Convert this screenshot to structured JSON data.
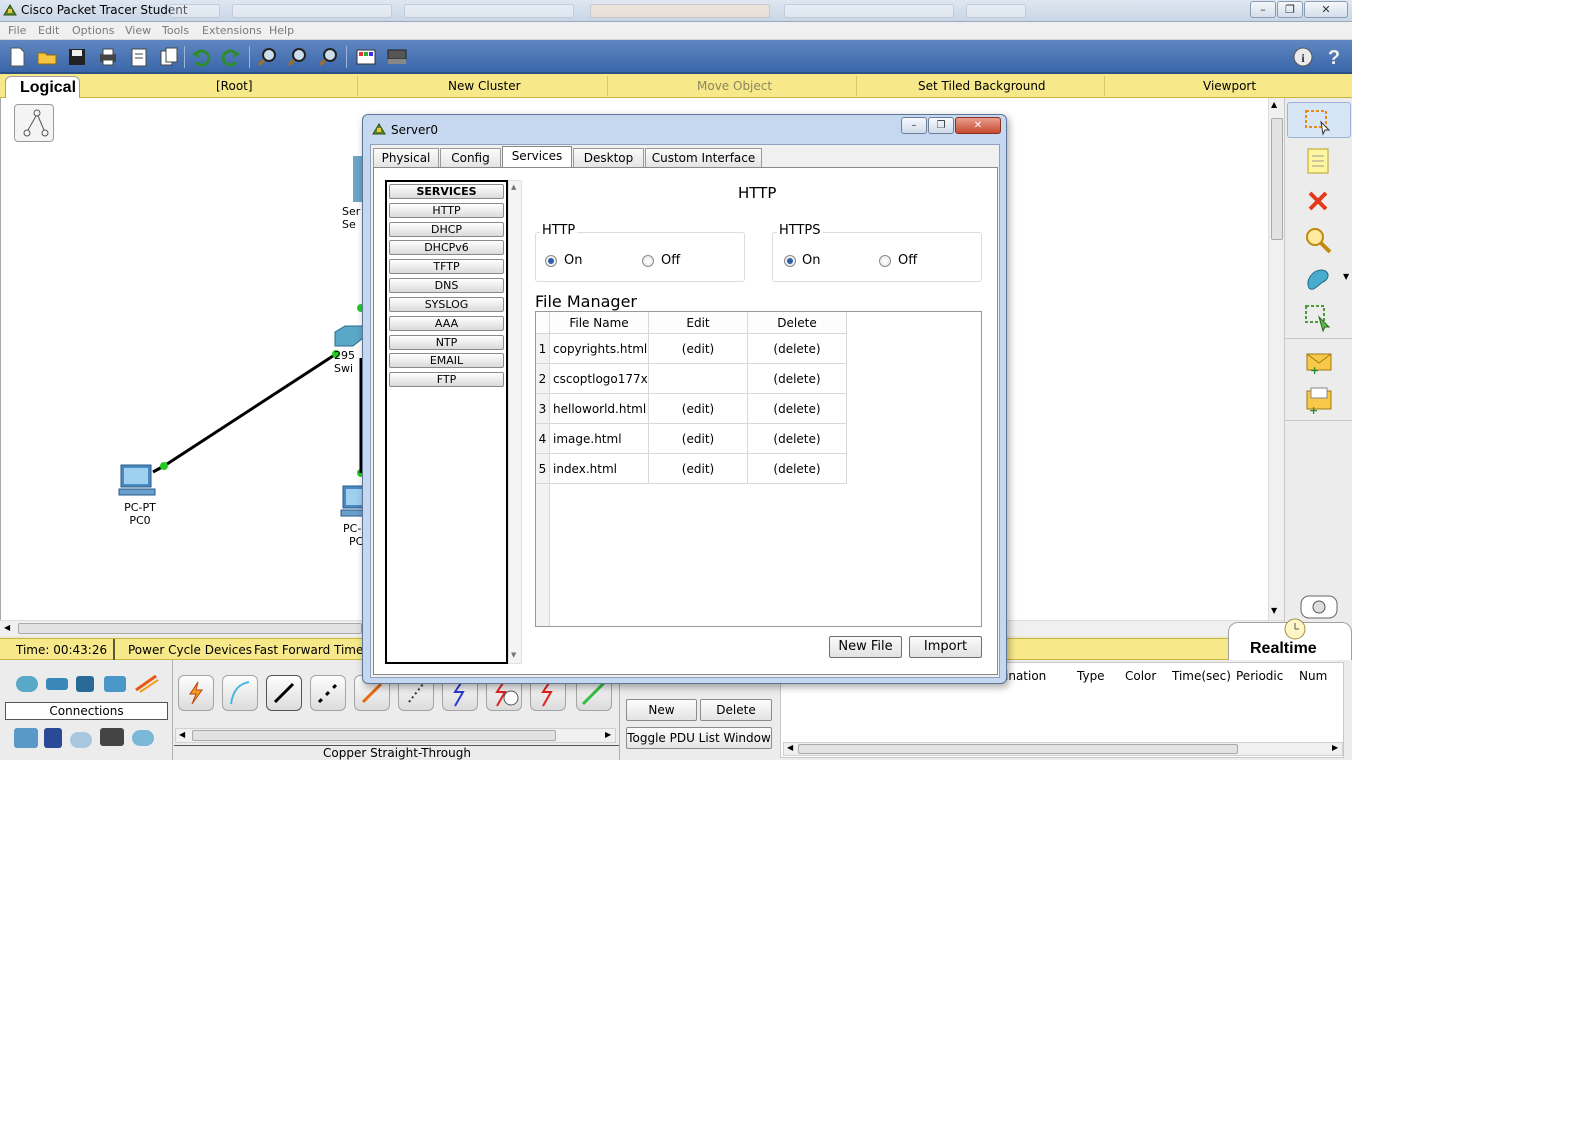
{
  "window": {
    "title": "Cisco Packet Tracer Student",
    "minimize": "–",
    "restore": "❐",
    "close": "✕"
  },
  "menu": [
    "File",
    "Edit",
    "Options",
    "View",
    "Tools",
    "Extensions",
    "Help"
  ],
  "toolbar_icons": [
    "new-file-icon",
    "open-folder-icon",
    "save-icon",
    "print-icon",
    "activity-wizard-icon",
    "copy-icon",
    "undo-icon",
    "redo-icon",
    "zoom-in-icon",
    "zoom-reset-icon",
    "zoom-out-icon",
    "palette-icon",
    "custom-device-icon",
    "info-icon",
    "help-icon"
  ],
  "logical_bar": {
    "tab": "Logical",
    "items": [
      "[Root]",
      "New Cluster",
      "Move Object",
      "Set Tiled Background",
      "Viewport"
    ]
  },
  "workspace": {
    "devices": [
      {
        "line1": "PC-PT",
        "line2": "PC0"
      },
      {
        "line1": "295",
        "line2": "Swi"
      },
      {
        "line1": "Ser",
        "line2": "Se"
      },
      {
        "line1": "PC-",
        "line2": "PC"
      }
    ]
  },
  "status": {
    "time": "Time: 00:43:26",
    "power_cycle": "Power Cycle Devices",
    "fast_forward": "Fast Forward Time",
    "mode": "Realtime"
  },
  "bottom": {
    "connections_label": "Connections",
    "connection_caption": "Copper Straight-Through",
    "new_button": "New",
    "delete_button": "Delete",
    "toggle_button": "Toggle PDU List Window",
    "pdu_columns": [
      "ination",
      "Type",
      "Color",
      "Time(sec)",
      "Periodic",
      "Num"
    ]
  },
  "dialog": {
    "title": "Server0",
    "tabs": [
      "Physical",
      "Config",
      "Services",
      "Desktop",
      "Custom Interface"
    ],
    "active_tab": "Services",
    "services": [
      "SERVICES",
      "HTTP",
      "DHCP",
      "DHCPv6",
      "TFTP",
      "DNS",
      "SYSLOG",
      "AAA",
      "NTP",
      "EMAIL",
      "FTP"
    ],
    "heading": "HTTP",
    "http_group": {
      "label": "HTTP",
      "on": "On",
      "off": "Off",
      "selected": "On"
    },
    "https_group": {
      "label": "HTTPS",
      "on": "On",
      "off": "Off",
      "selected": "On"
    },
    "file_manager": {
      "title": "File Manager",
      "columns": [
        "File Name",
        "Edit",
        "Delete"
      ],
      "rows": [
        {
          "num": "1",
          "name": "copyrights.html",
          "edit": "(edit)",
          "delete": "(delete)"
        },
        {
          "num": "2",
          "name": "cscoptlogo177x...",
          "edit": "",
          "delete": "(delete)"
        },
        {
          "num": "3",
          "name": "helloworld.html",
          "edit": "(edit)",
          "delete": "(delete)"
        },
        {
          "num": "4",
          "name": "image.html",
          "edit": "(edit)",
          "delete": "(delete)"
        },
        {
          "num": "5",
          "name": "index.html",
          "edit": "(edit)",
          "delete": "(delete)"
        }
      ]
    },
    "new_file_button": "New File",
    "import_button": "Import"
  }
}
